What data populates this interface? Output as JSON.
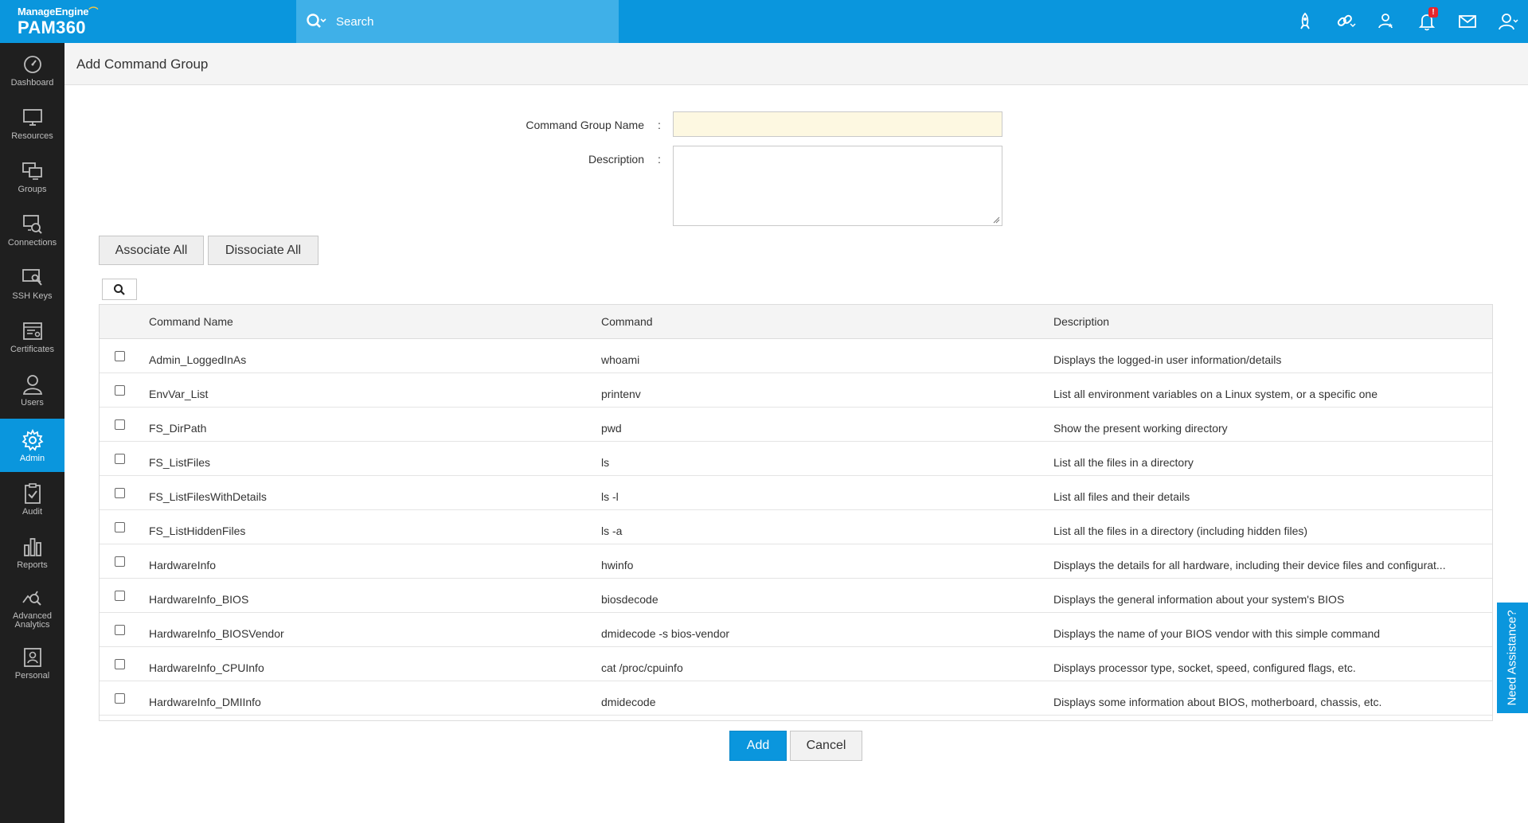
{
  "app": {
    "brand": "ManageEngine",
    "product": "PAM360"
  },
  "search": {
    "placeholder": "Search"
  },
  "top_icons": [
    "rocket-icon",
    "link-icon",
    "user-star-icon",
    "bell-icon",
    "mail-icon",
    "user-icon"
  ],
  "notification_badge": "!",
  "sidebar": {
    "items": [
      {
        "label": "Dashboard",
        "icon": "dashboard-icon"
      },
      {
        "label": "Resources",
        "icon": "monitor-icon"
      },
      {
        "label": "Groups",
        "icon": "groups-icon"
      },
      {
        "label": "Connections",
        "icon": "connections-icon"
      },
      {
        "label": "SSH Keys",
        "icon": "ssh-keys-icon"
      },
      {
        "label": "Certificates",
        "icon": "certificates-icon"
      },
      {
        "label": "Users",
        "icon": "users-icon"
      },
      {
        "label": "Admin",
        "icon": "gear-icon",
        "active": true
      },
      {
        "label": "Audit",
        "icon": "audit-icon"
      },
      {
        "label": "Reports",
        "icon": "reports-icon"
      },
      {
        "label": "Advanced Analytics",
        "icon": "analytics-icon"
      },
      {
        "label": "Personal",
        "icon": "personal-icon"
      }
    ]
  },
  "page": {
    "title": "Add Command Group"
  },
  "form": {
    "name_label": "Command Group Name",
    "name_value": "",
    "description_label": "Description",
    "description_value": "",
    "colon": ":"
  },
  "actions": {
    "associate_all": "Associate All",
    "dissociate_all": "Dissociate All",
    "add": "Add",
    "cancel": "Cancel"
  },
  "table": {
    "headers": {
      "name": "Command Name",
      "command": "Command",
      "description": "Description"
    },
    "rows": [
      {
        "name": "Admin_LoggedInAs",
        "command": "whoami",
        "description": "Displays the logged-in user information/details"
      },
      {
        "name": "EnvVar_List",
        "command": "printenv",
        "description": "List all environment variables on a Linux system, or a specific one"
      },
      {
        "name": "FS_DirPath",
        "command": "pwd",
        "description": "Show the present working directory"
      },
      {
        "name": "FS_ListFiles",
        "command": "ls",
        "description": "List all the files in a directory"
      },
      {
        "name": "FS_ListFilesWithDetails",
        "command": "ls -l",
        "description": "List all files and their details"
      },
      {
        "name": "FS_ListHiddenFiles",
        "command": "ls -a",
        "description": "List all the files in a directory (including hidden files)"
      },
      {
        "name": "HardwareInfo",
        "command": "hwinfo",
        "description": "Displays the details for all hardware, including their device files and configurat..."
      },
      {
        "name": "HardwareInfo_BIOS",
        "command": "biosdecode",
        "description": "Displays the general information about your system's BIOS"
      },
      {
        "name": "HardwareInfo_BIOSVendor",
        "command": "dmidecode -s bios-vendor",
        "description": "Displays the name of your BIOS vendor with this simple command"
      },
      {
        "name": "HardwareInfo_CPUInfo",
        "command": "cat /proc/cpuinfo",
        "description": "Displays processor type, socket, speed, configured flags, etc."
      },
      {
        "name": "HardwareInfo_DMIInfo",
        "command": "dmidecode",
        "description": "Displays some information about BIOS, motherboard, chassis, etc."
      }
    ]
  },
  "assistance": "Need Assistance?"
}
